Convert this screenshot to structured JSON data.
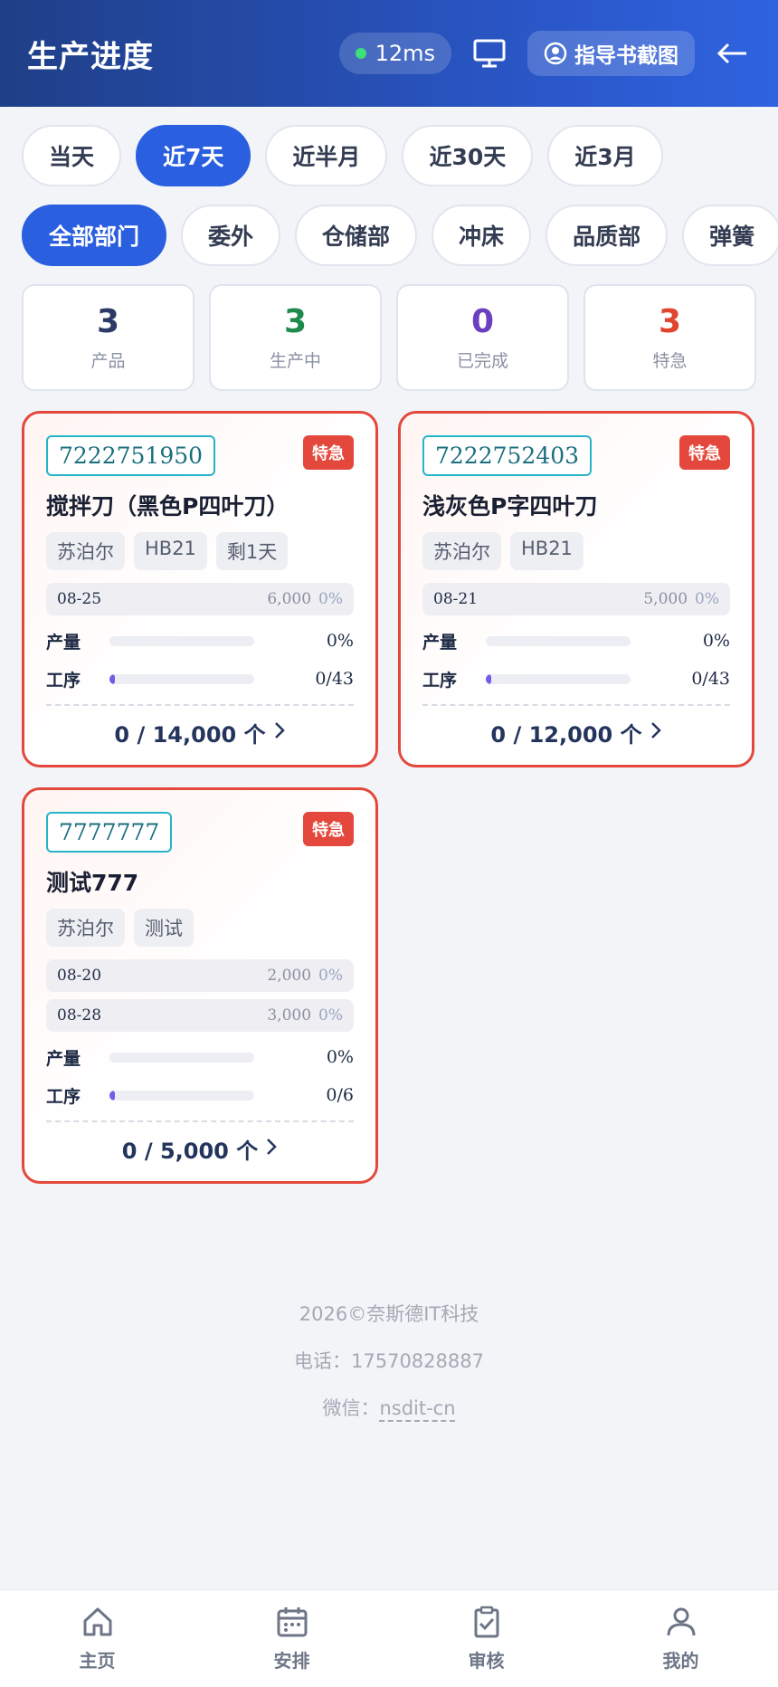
{
  "header": {
    "title": "生产进度",
    "ping": "12ms",
    "guide_label": "指导书截图"
  },
  "time_filters": [
    "当天",
    "近7天",
    "近半月",
    "近30天",
    "近3月"
  ],
  "time_active": 1,
  "departments": [
    "全部部门",
    "委外",
    "仓储部",
    "冲床",
    "品质部",
    "弹簧"
  ],
  "dept_active": 0,
  "stats": [
    {
      "value": "3",
      "label": "产品",
      "color": "#2b3a67"
    },
    {
      "value": "3",
      "label": "生产中",
      "color": "#1e8a4c"
    },
    {
      "value": "0",
      "label": "已完成",
      "color": "#6a3fc0"
    },
    {
      "value": "3",
      "label": "特急",
      "color": "#e0452f"
    }
  ],
  "cards": [
    {
      "code": "7222751950",
      "badge": "特急",
      "name": "搅拌刀（黑色P四叶刀）",
      "tags": [
        "苏泊尔",
        "HB21",
        "剩1天"
      ],
      "orders": [
        {
          "date": "08-25",
          "qty": "6,000",
          "pct": "0%"
        }
      ],
      "output_label": "产量",
      "output_value": "0%",
      "output_fraction": 0,
      "process_label": "工序",
      "process_value": "0/43",
      "process_fraction": 0.03,
      "total": "0 / 14,000 个"
    },
    {
      "code": "7222752403",
      "badge": "特急",
      "name": "浅灰色P字四叶刀",
      "tags": [
        "苏泊尔",
        "HB21"
      ],
      "orders": [
        {
          "date": "08-21",
          "qty": "5,000",
          "pct": "0%"
        }
      ],
      "output_label": "产量",
      "output_value": "0%",
      "output_fraction": 0,
      "process_label": "工序",
      "process_value": "0/43",
      "process_fraction": 0.03,
      "total": "0 / 12,000 个"
    },
    {
      "code": "7777777",
      "badge": "特急",
      "name": "测试777",
      "tags": [
        "苏泊尔",
        "测试"
      ],
      "orders": [
        {
          "date": "08-20",
          "qty": "2,000",
          "pct": "0%"
        },
        {
          "date": "08-28",
          "qty": "3,000",
          "pct": "0%"
        }
      ],
      "output_label": "产量",
      "output_value": "0%",
      "output_fraction": 0,
      "process_label": "工序",
      "process_value": "0/6",
      "process_fraction": 0.02,
      "total": "0 / 5,000 个"
    }
  ],
  "footer": {
    "copyright": "2026©奈斯德IT科技",
    "phone": "电话：17570828887",
    "wechat_prefix": "微信：",
    "wechat_id": "nsdit-cn"
  },
  "tabbar": [
    {
      "label": "主页",
      "icon": "home-icon"
    },
    {
      "label": "安排",
      "icon": "calendar-icon"
    },
    {
      "label": "审核",
      "icon": "clipboard-check-icon"
    },
    {
      "label": "我的",
      "icon": "user-icon"
    }
  ]
}
